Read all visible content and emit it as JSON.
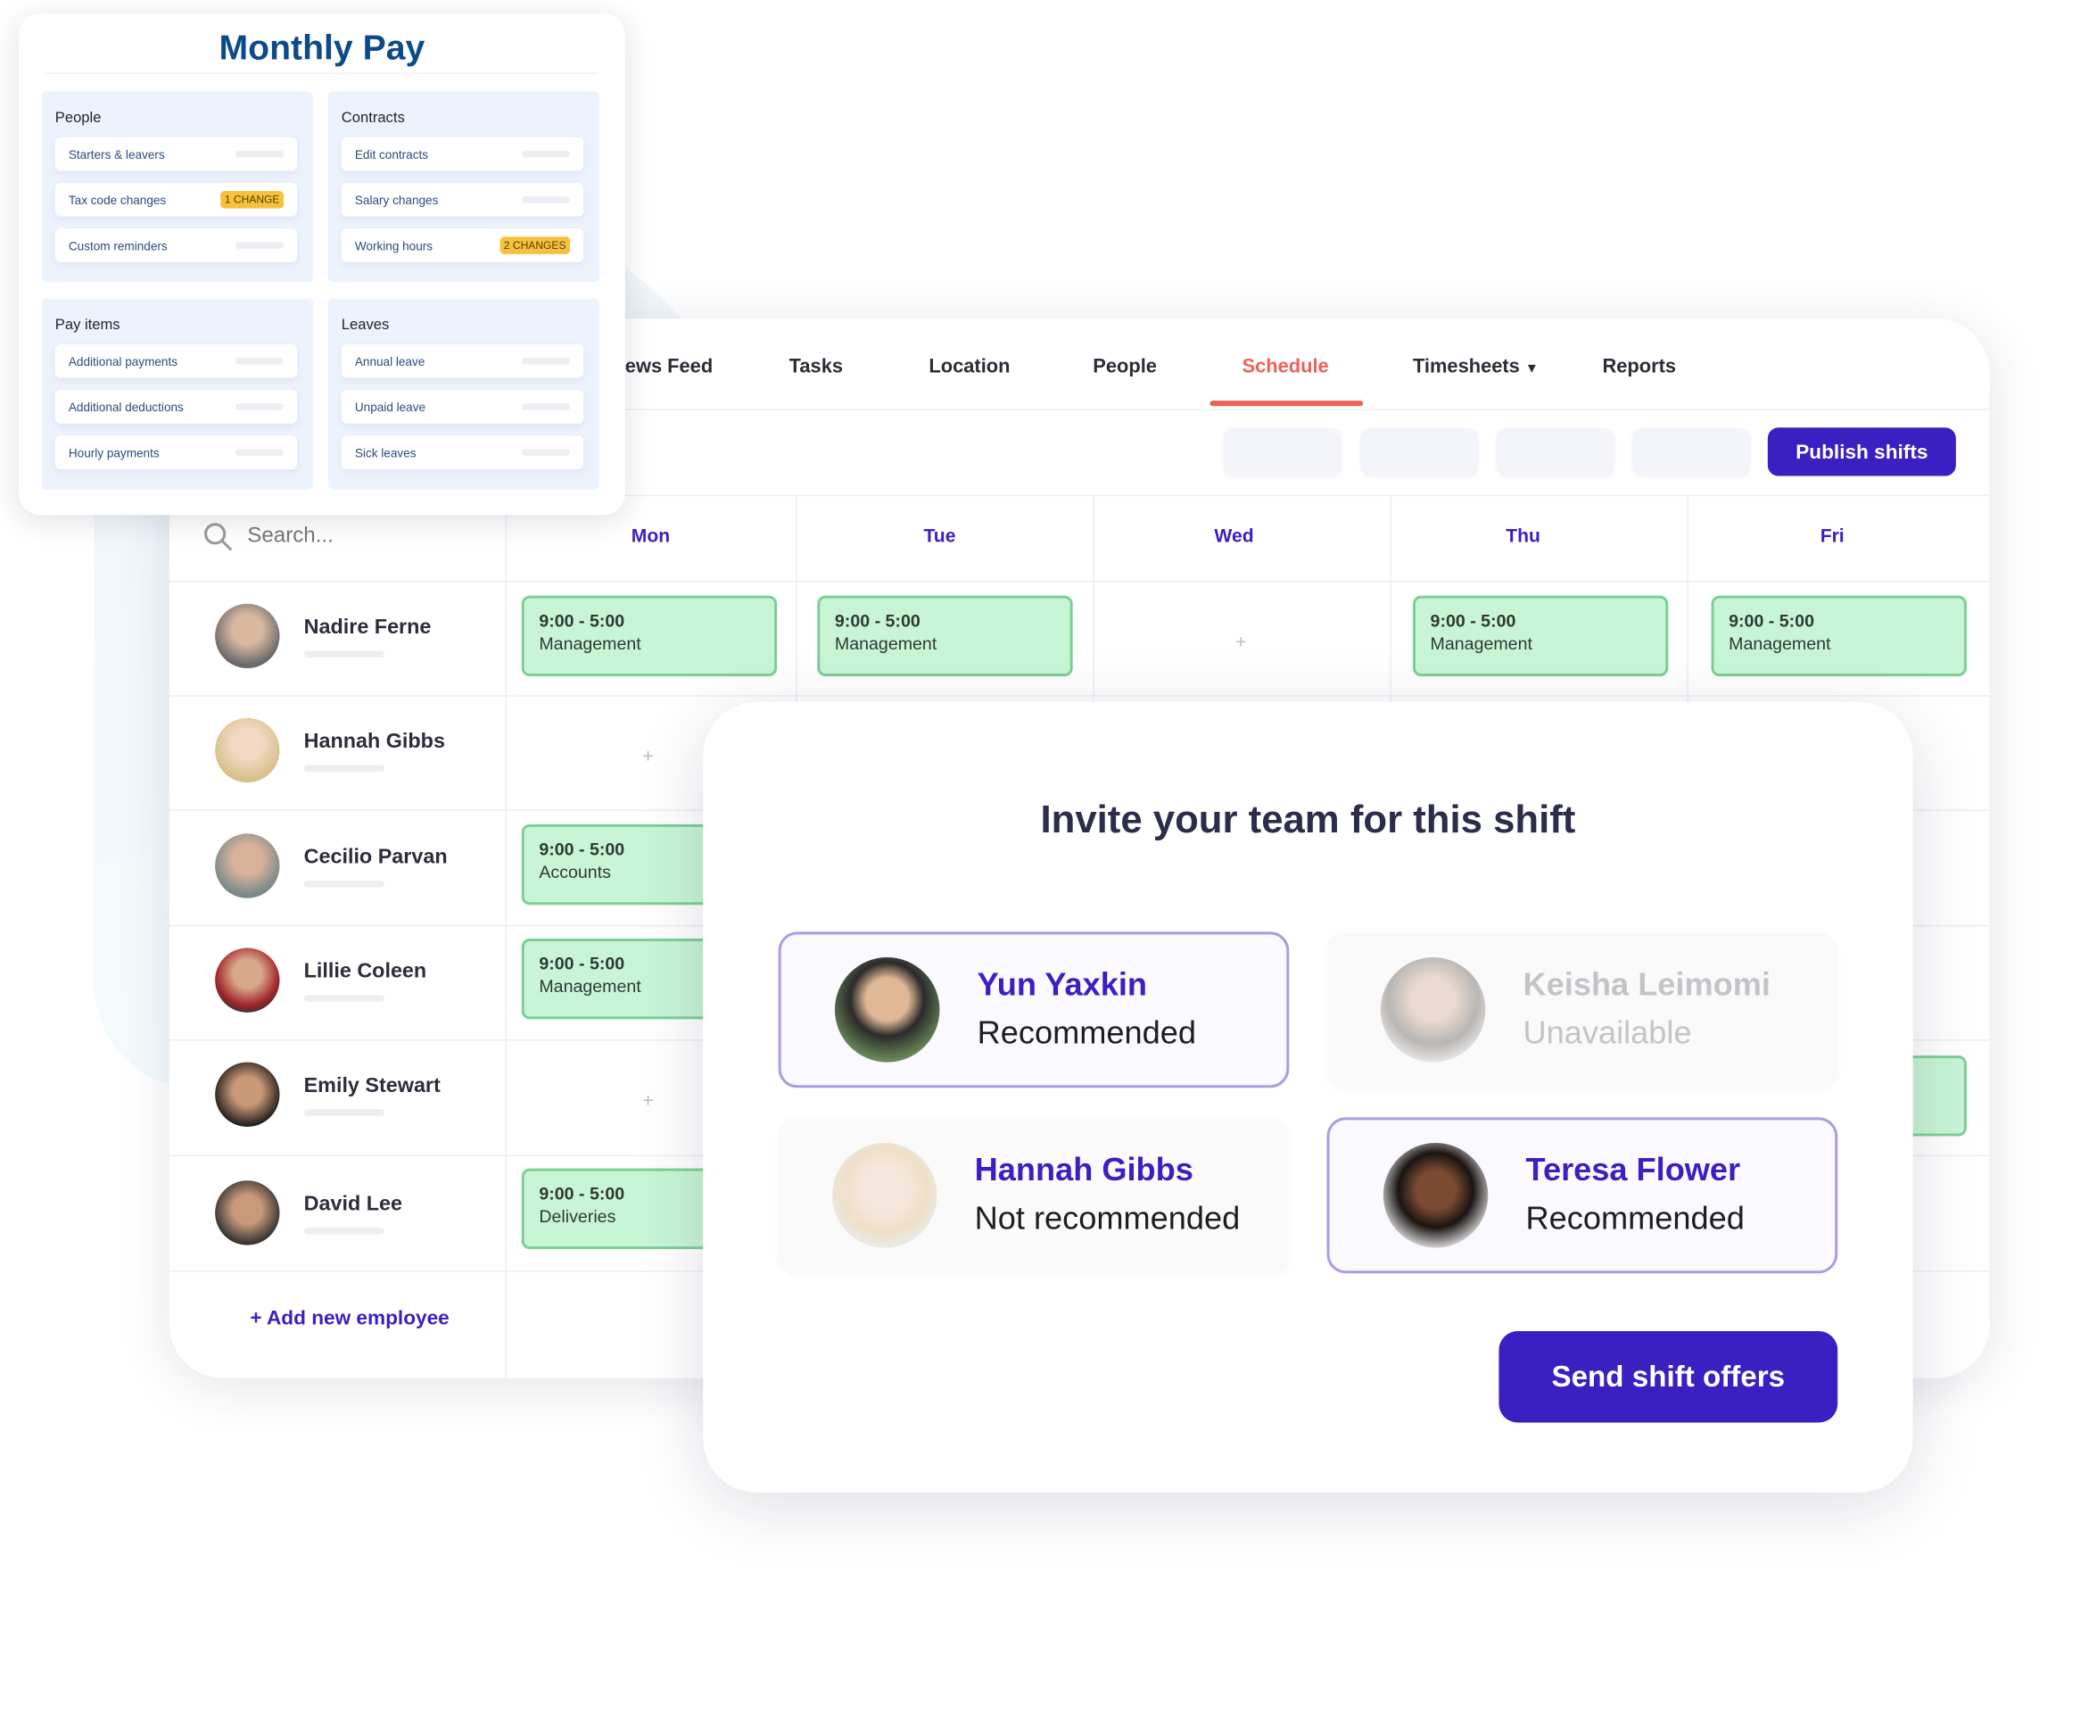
{
  "monthly_pay": {
    "title": "Monthly Pay",
    "sections": [
      {
        "heading": "People",
        "items": [
          {
            "label": "Starters & leavers"
          },
          {
            "label": "Tax code changes",
            "badge": "1 CHANGE"
          },
          {
            "label": "Custom reminders"
          }
        ]
      },
      {
        "heading": "Contracts",
        "items": [
          {
            "label": "Edit contracts"
          },
          {
            "label": "Salary changes"
          },
          {
            "label": "Working hours",
            "badge": "2 CHANGES"
          }
        ]
      },
      {
        "heading": "Pay items",
        "items": [
          {
            "label": "Additional payments"
          },
          {
            "label": "Additional deductions"
          },
          {
            "label": "Hourly payments"
          }
        ]
      },
      {
        "heading": "Leaves",
        "items": [
          {
            "label": "Annual leave"
          },
          {
            "label": "Unpaid leave"
          },
          {
            "label": "Sick leaves"
          }
        ]
      }
    ]
  },
  "nav": {
    "tabs": [
      {
        "label": "ews Feed"
      },
      {
        "label": "Tasks"
      },
      {
        "label": "Location"
      },
      {
        "label": "People"
      },
      {
        "label": "Schedule",
        "active": true
      },
      {
        "label": "Timesheets"
      },
      {
        "label": "Reports"
      }
    ]
  },
  "toolbar": {
    "publish_label": "Publish shifts"
  },
  "schedule": {
    "search_placeholder": "Search...",
    "days": [
      "Mon",
      "Tue",
      "Wed",
      "Thu",
      "Fri"
    ],
    "employees": [
      {
        "name": "Nadire Ferne",
        "shifts": [
          {
            "time": "9:00 - 5:00",
            "role": "Management"
          },
          {
            "time": "9:00 - 5:00",
            "role": "Management"
          },
          null,
          {
            "time": "9:00 - 5:00",
            "role": "Management"
          },
          {
            "time": "9:00 - 5:00",
            "role": "Management"
          }
        ]
      },
      {
        "name": "Hannah Gibbs",
        "shifts": [
          null
        ]
      },
      {
        "name": "Cecilio Parvan",
        "shifts": [
          {
            "time": "9:00 - 5:00",
            "role": "Accounts"
          }
        ]
      },
      {
        "name": "Lillie Coleen",
        "shifts": [
          {
            "time": "9:00 - 5:00",
            "role": "Management"
          }
        ]
      },
      {
        "name": "Emily Stewart",
        "shifts": [
          null
        ]
      },
      {
        "name": "David Lee",
        "shifts": [
          {
            "time": "9:00 - 5:00",
            "role": "Deliveries"
          }
        ]
      }
    ],
    "add_label": "+ Add new employee"
  },
  "modal": {
    "title": "Invite your team for this shift",
    "candidates": [
      {
        "name": "Yun Yaxkin",
        "status": "Recommended"
      },
      {
        "name": "Keisha Leimomi",
        "status": "Unavailable"
      },
      {
        "name": "Hannah Gibbs",
        "status": "Not recommended"
      },
      {
        "name": "Teresa Flower",
        "status": "Recommended"
      }
    ],
    "send_label": "Send shift offers"
  },
  "colors": {
    "accent": "#3a1fc1",
    "active_tab": "#f0605a",
    "shift_fill": "#c8f5d6",
    "shift_border": "#7ccf95",
    "title_blue": "#0d4a8a",
    "badge": "#f6c23e"
  }
}
